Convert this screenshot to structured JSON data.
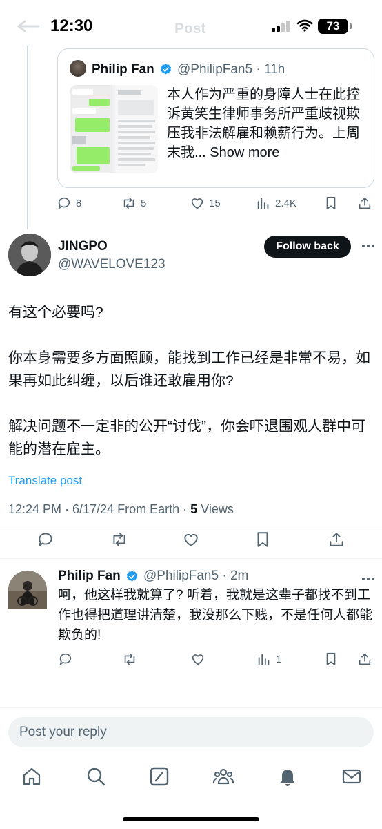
{
  "status_bar": {
    "time": "12:30",
    "ghost_title": "Post",
    "battery": "73"
  },
  "quoted_post": {
    "author_name": "Philip Fan",
    "handle_time": "@PhilipFan5 · 11h",
    "text": "本人作为严重的身障人士在此控诉黄笑生律师事务所严重歧视欺压我非法解雇和赖薪行为。上周末我...",
    "show_more": "Show more",
    "actions": {
      "replies": "8",
      "reposts": "5",
      "likes": "15",
      "views": "2.4K"
    }
  },
  "main_post": {
    "author_name": "JINGPO",
    "handle": "@WAVELOVE123",
    "follow_label": "Follow back",
    "paragraph_1": "有这个必要吗?",
    "paragraph_2": "你本身需要多方面照顾，能找到工作已经是非常不易，如果再如此纠缠，以后谁还敢雇用你?",
    "paragraph_3": "解决问题不一定非的公开“讨伐”，你会吓退围观人群中可能的潜在雇主。",
    "translate_label": "Translate post",
    "meta_prefix": "12:24 PM · 6/17/24 From Earth · ",
    "views_count": "5",
    "views_label": " Views"
  },
  "reply_post": {
    "author_name": "Philip Fan",
    "handle_time": "@PhilipFan5 · 2m",
    "text": "呵，他这样我就算了? 听着，我就是这辈子都找不到工作也得把道理讲清楚，我没那么下贱，不是任何人都能欺负的!",
    "actions": {
      "views": "1"
    }
  },
  "reply_input": {
    "placeholder": "Post your reply"
  },
  "colors": {
    "accent": "#1d9bf0",
    "text": "#0f1419",
    "secondary": "#536471",
    "border": "#cfd9de"
  },
  "tab_bar": [
    "home-icon",
    "search-icon",
    "grok-icon",
    "communities-icon",
    "notifications-icon",
    "messages-icon"
  ]
}
